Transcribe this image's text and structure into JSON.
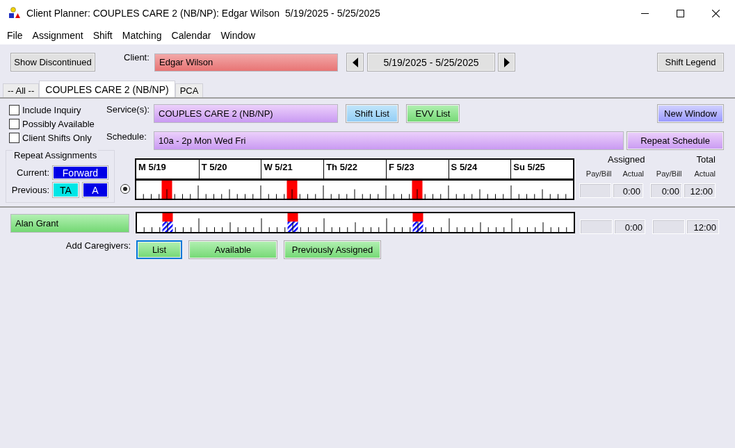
{
  "window": {
    "title": "Client Planner: COUPLES CARE 2 (NB/NP): Edgar Wilson  5/19/2025 - 5/25/2025"
  },
  "menu": [
    "File",
    "Assignment",
    "Shift",
    "Matching",
    "Calendar",
    "Window"
  ],
  "toolbar": {
    "show_discontinued": "Show Discontinued",
    "client_label": "Client:",
    "client": "Edgar Wilson",
    "date_range": "5/19/2025 - 5/25/2025",
    "shift_legend": "Shift Legend"
  },
  "tabs": [
    {
      "label": "-- All --",
      "selected": false
    },
    {
      "label": "COUPLES CARE 2 (NB/NP)",
      "selected": true
    },
    {
      "label": "PCA",
      "selected": false
    }
  ],
  "filters": [
    {
      "label": "Include Inquiry",
      "checked": false
    },
    {
      "label": "Possibly Available",
      "checked": false
    },
    {
      "label": "Client Shifts Only",
      "checked": false
    }
  ],
  "service": {
    "label": "Service(s):",
    "value": "COUPLES CARE 2 (NB/NP)",
    "shift_list_button": "Shift List",
    "evv_list_button": "EVV List",
    "new_window_button": "New Window"
  },
  "schedule": {
    "label": "Schedule:",
    "value": "10a - 2p Mon Wed Fri",
    "repeat_button": "Repeat Schedule"
  },
  "repeat_assignments": {
    "title": "Repeat Assignments",
    "current_label": "Current:",
    "current": [
      {
        "label": "Forward",
        "color": "#0000e6"
      }
    ],
    "previous_label": "Previous:",
    "previous": [
      {
        "label": "TA",
        "color": "#00e6e6"
      },
      {
        "label": "A",
        "color": "#0000e6"
      }
    ]
  },
  "calendar": {
    "days": [
      "M 5/19",
      "T 5/20",
      "W 5/21",
      "Th 5/22",
      "F 5/23",
      "S 5/24",
      "Su 5/25"
    ],
    "totals_header": {
      "assigned": "Assigned",
      "total": "Total",
      "columns": [
        "Pay/Bill",
        "Actual",
        "Pay/Bill",
        "Actual"
      ]
    },
    "client_row": {
      "selected": true,
      "days": [
        {
          "shift": true
        },
        {
          "shift": false
        },
        {
          "shift": true
        },
        {
          "shift": false
        },
        {
          "shift": true
        },
        {
          "shift": false
        },
        {
          "shift": false
        }
      ],
      "assigned_actual": "0:00",
      "total_pay_bill": "0:00",
      "total_actual": "12:00"
    },
    "caregivers": [
      {
        "name": "Alan Grant",
        "days": [
          {
            "shift": true,
            "assigned": true
          },
          {
            "shift": false,
            "assigned": false
          },
          {
            "shift": true,
            "assigned": true
          },
          {
            "shift": false,
            "assigned": false
          },
          {
            "shift": true,
            "assigned": true
          },
          {
            "shift": false,
            "assigned": false
          },
          {
            "shift": false,
            "assigned": false
          }
        ],
        "assigned_actual": "0:00",
        "total_actual": "12:00"
      }
    ]
  },
  "add_caregivers": {
    "label": "Add Caregivers:",
    "buttons": [
      {
        "label": "List",
        "focused": true
      },
      {
        "label": "Available",
        "focused": false
      },
      {
        "label": "Previously Assigned",
        "focused": false
      }
    ]
  }
}
